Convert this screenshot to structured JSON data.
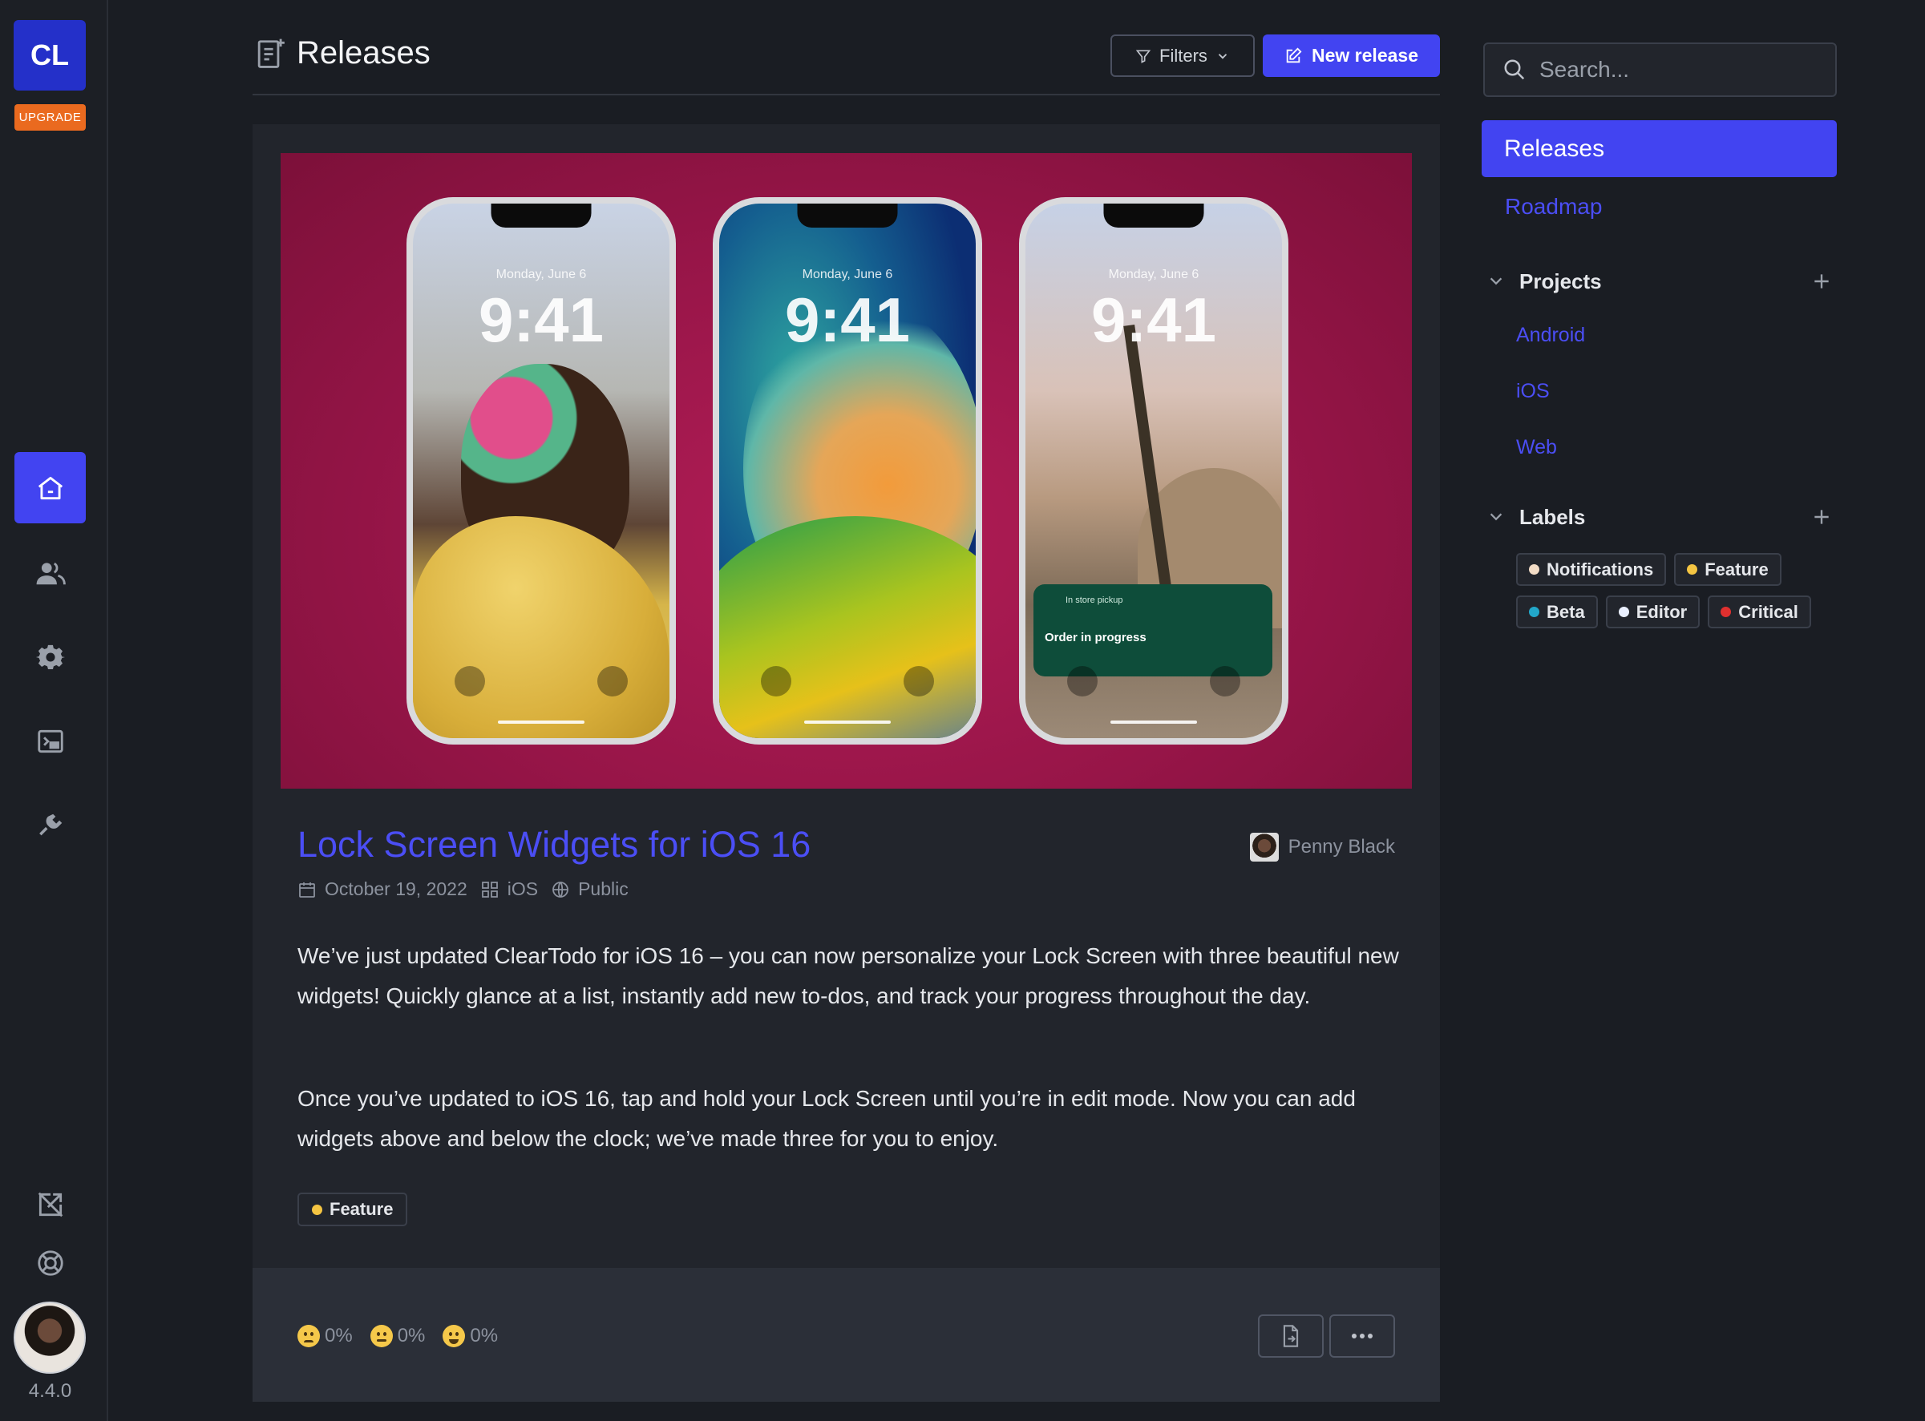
{
  "app": {
    "logo_text": "CL",
    "upgrade_label": "UPGRADE",
    "version": "4.4.0"
  },
  "rail": {
    "items": [
      {
        "icon": "home-icon",
        "active": true
      },
      {
        "icon": "users-icon",
        "active": false
      },
      {
        "icon": "gear-icon",
        "active": false
      },
      {
        "icon": "widget-icon",
        "active": false
      },
      {
        "icon": "plug-icon",
        "active": false
      }
    ],
    "bottom_items": [
      {
        "icon": "external-link-icon"
      },
      {
        "icon": "lifebuoy-icon"
      }
    ]
  },
  "header": {
    "title": "Releases",
    "filters_label": "Filters",
    "new_release_label": "New release"
  },
  "release": {
    "title": "Lock Screen Widgets for iOS 16",
    "author": "Penny Black",
    "date": "October 19, 2022",
    "project": "iOS",
    "visibility": "Public",
    "paragraphs": [
      "We’ve just updated ClearTodo for iOS 16 – you can now personalize your Lock Screen with three beautiful new widgets! Quickly glance at a list, instantly add new to-dos, and track your progress throughout the day.",
      "Once you’ve updated to iOS 16, tap and hold your Lock Screen until you’re in edit mode. Now you can add widgets above and below the clock; we’ve made three for you to enjoy."
    ],
    "tag": {
      "label": "Feature",
      "color": "#f5c542"
    },
    "hero": {
      "phones": [
        {
          "date": "Monday, June 6",
          "time": "9:41"
        },
        {
          "date": "Monday, June 6",
          "time": "9:41"
        },
        {
          "date": "Monday, June 6",
          "time": "9:41"
        }
      ],
      "widget_caption": "In store pickup",
      "widget_title": "Order in progress"
    },
    "reactions": [
      {
        "emoji": "sad",
        "value": "0%"
      },
      {
        "emoji": "neutral",
        "value": "0%"
      },
      {
        "emoji": "happy",
        "value": "0%"
      }
    ]
  },
  "sidebar": {
    "search_placeholder": "Search...",
    "nav": [
      {
        "label": "Releases",
        "active": true
      },
      {
        "label": "Roadmap",
        "active": false
      }
    ],
    "projects_heading": "Projects",
    "projects": [
      "Android",
      "iOS",
      "Web"
    ],
    "labels_heading": "Labels",
    "labels": [
      {
        "label": "Notifications",
        "color": "#f2dcc6"
      },
      {
        "label": "Feature",
        "color": "#f5c542"
      },
      {
        "label": "Beta",
        "color": "#22a7c9"
      },
      {
        "label": "Editor",
        "color": "#eaf0ff"
      },
      {
        "label": "Critical",
        "color": "#e0302f"
      }
    ]
  },
  "colors": {
    "accent": "#4244f1",
    "link": "#4b4ef5",
    "background": "#1a1d23",
    "card": "#22252c",
    "upgrade": "#ea6a1f"
  }
}
